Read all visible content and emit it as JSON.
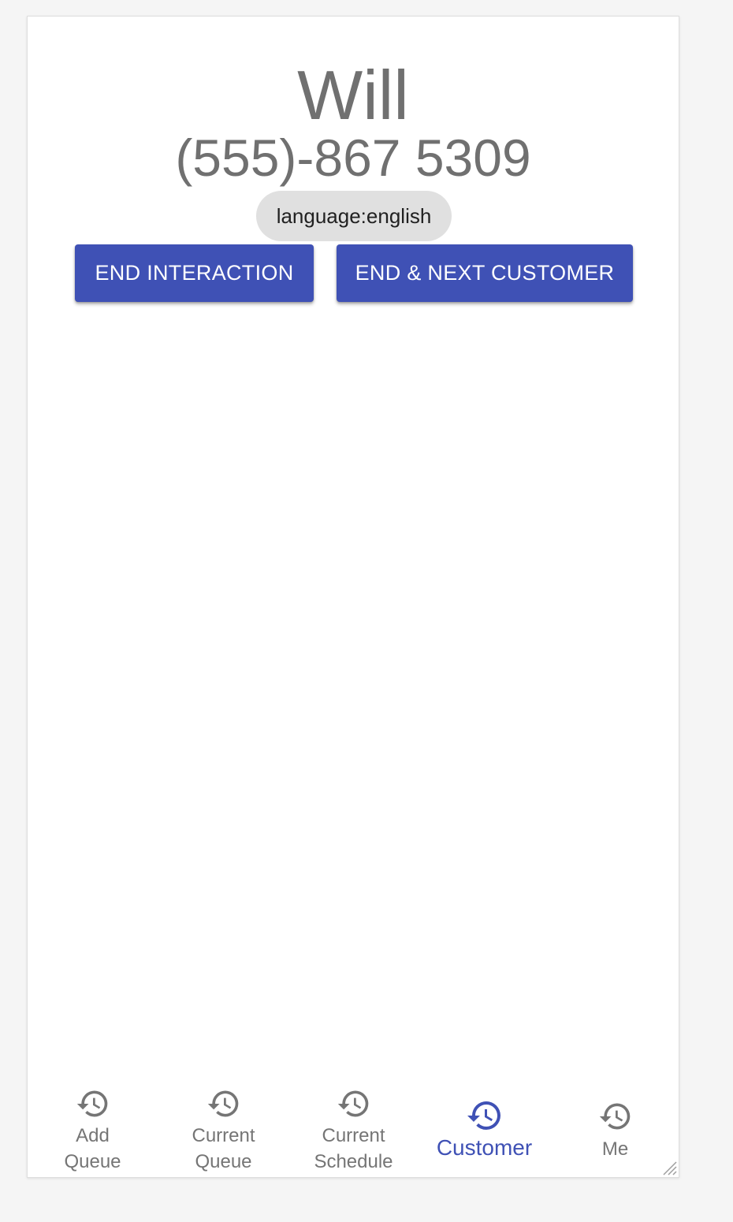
{
  "customer": {
    "name": "Will",
    "phone": "(555)-867 5309",
    "language_chip": "language:english"
  },
  "actions": {
    "end_interaction_label": "END INTERACTION",
    "end_next_label": "END & NEXT CUSTOMER"
  },
  "bottom_nav": {
    "items": [
      {
        "line1": "Add",
        "line2": "Queue",
        "icon": "history-icon"
      },
      {
        "line1": "Current",
        "line2": "Queue",
        "icon": "history-icon"
      },
      {
        "line1": "Current",
        "line2": "Schedule",
        "icon": "history-icon"
      },
      {
        "label": "Customer",
        "icon": "history-icon",
        "active": true
      },
      {
        "label": "Me",
        "icon": "history-icon"
      }
    ]
  },
  "colors": {
    "primary": "#3f51b5",
    "inactive": "#757575",
    "chip_bg": "#e0e0e0",
    "heading": "#707070"
  }
}
